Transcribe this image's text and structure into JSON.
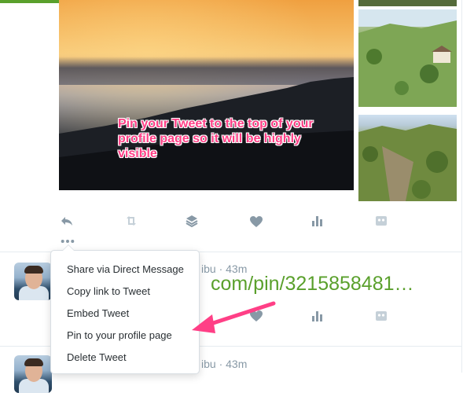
{
  "tweet": {
    "overlay_text": "Pin your Tweet to the top of your profile page so it will be highly visible"
  },
  "menu": {
    "items": [
      {
        "label": "Share via Direct Message"
      },
      {
        "label": "Copy link to Tweet"
      },
      {
        "label": "Embed Tweet"
      },
      {
        "label": "Pin to your profile page"
      },
      {
        "label": "Delete Tweet"
      }
    ]
  },
  "rows": [
    {
      "handle_suffix": "ibu · 43m",
      "link_text": "com/pin/3215858481…"
    },
    {
      "handle_suffix": "ibu · 43m"
    }
  ],
  "icons": {
    "reply": "reply-icon",
    "retweet": "retweet-icon",
    "buffer": "layers-icon",
    "like": "heart-icon",
    "analytics": "bar-chart-icon",
    "extension": "extension-icon",
    "more": "more-dots-icon"
  },
  "colors": {
    "accent_green": "#5aa02c",
    "annotation_pink": "#ff3f86",
    "icon_gray": "#8899a6"
  }
}
